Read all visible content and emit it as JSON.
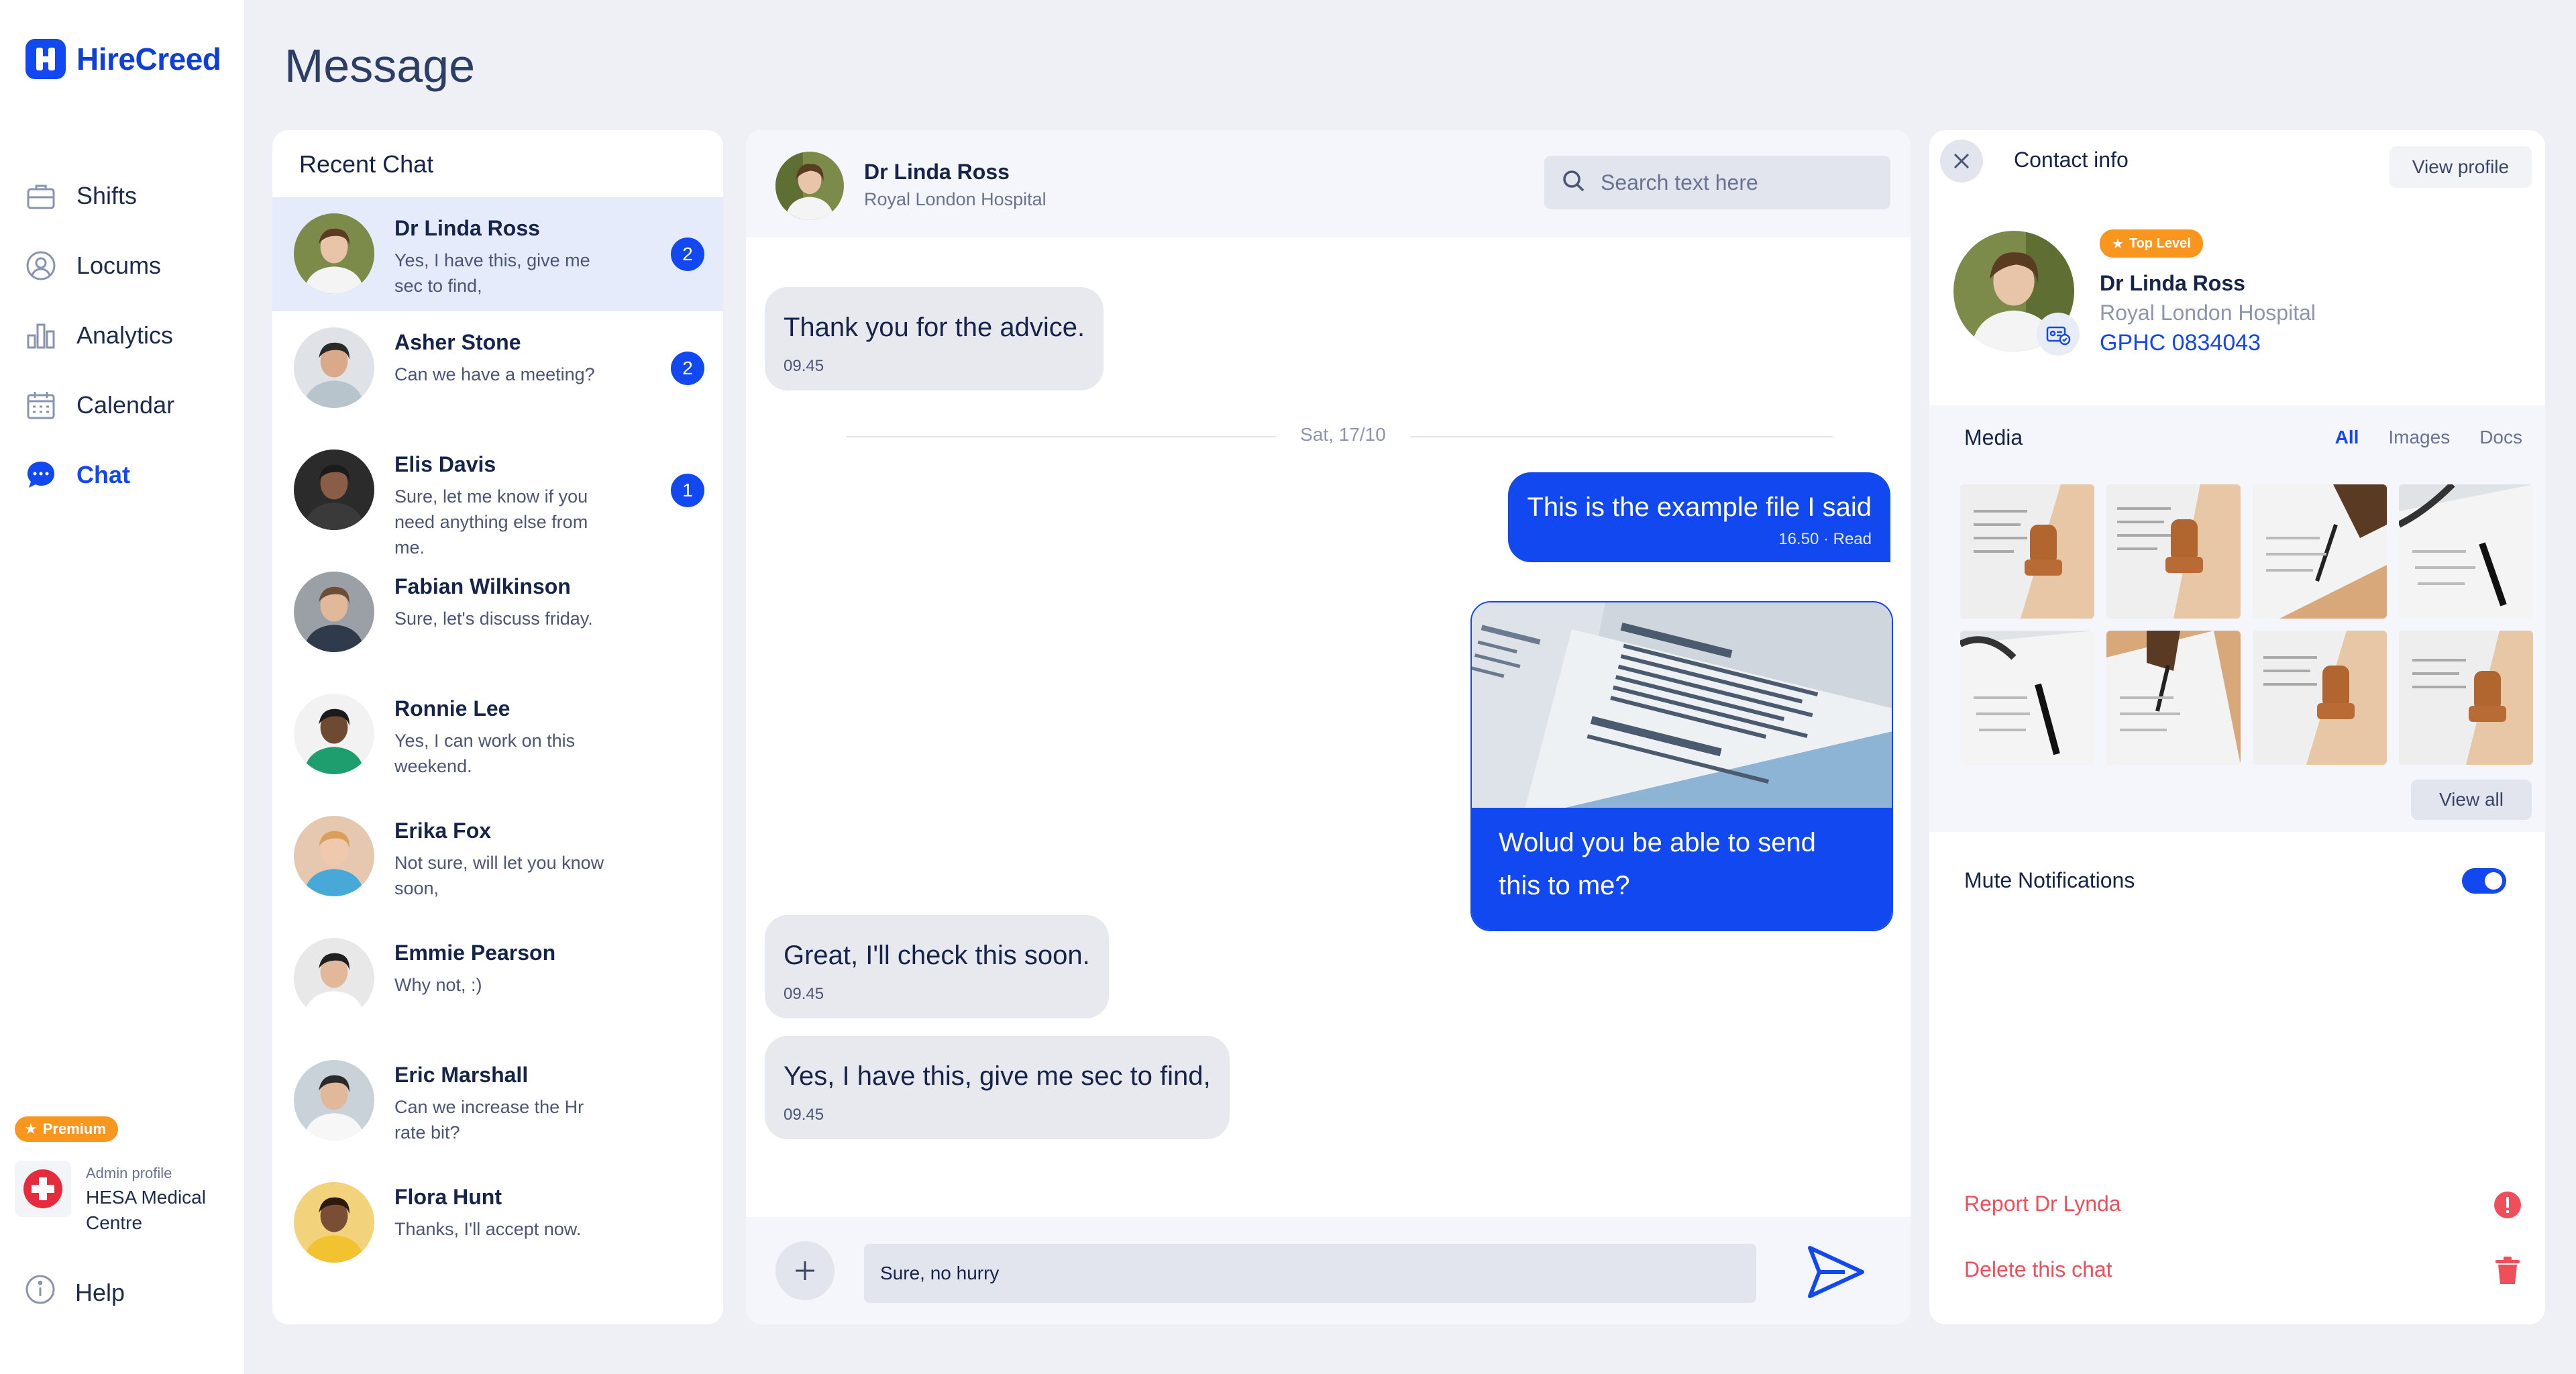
{
  "app": {
    "logo_text": "HireCreed",
    "brand_color": "#1148ef"
  },
  "sidebar": {
    "items": [
      {
        "label": "Shifts",
        "icon": "briefcase-icon"
      },
      {
        "label": "Locums",
        "icon": "user-circle-icon"
      },
      {
        "label": "Analytics",
        "icon": "bar-chart-icon"
      },
      {
        "label": "Calendar",
        "icon": "calendar-icon"
      },
      {
        "label": "Chat",
        "icon": "chat-bubble-icon",
        "active": true
      }
    ],
    "premium_label": "Premium",
    "admin_label": "Admin profile",
    "admin_name": "HESA Medical Centre",
    "help_label": "Help"
  },
  "page_title": "Message",
  "recent_chat": {
    "title": "Recent Chat",
    "chats": [
      {
        "name": "Dr Linda Ross",
        "snippet": "Yes, I have this, give me sec to find,",
        "unread": "2",
        "active": true
      },
      {
        "name": "Asher Stone",
        "snippet": "Can we have a meeting?",
        "unread": "2"
      },
      {
        "name": "Elis Davis",
        "snippet": "Sure, let me know if you need anything else from me.",
        "unread": "1"
      },
      {
        "name": "Fabian Wilkinson",
        "snippet": "Sure, let's discuss friday.",
        "unread": ""
      },
      {
        "name": "Ronnie Lee",
        "snippet": "Yes, I can work on this weekend.",
        "unread": ""
      },
      {
        "name": "Erika Fox",
        "snippet": "Not sure, will let you know soon,",
        "unread": ""
      },
      {
        "name": "Emmie Pearson",
        "snippet": "Why not, :)",
        "unread": ""
      },
      {
        "name": "Eric Marshall",
        "snippet": "Can we increase the Hr rate bit?",
        "unread": ""
      },
      {
        "name": "Flora Hunt",
        "snippet": "Thanks,  I'll accept now.",
        "unread": ""
      }
    ]
  },
  "conversation": {
    "name": "Dr Linda Ross",
    "subtitle": "Royal London Hospital",
    "search_placeholder": "Search text here",
    "messages": [
      {
        "text": "Thank you for the advice.",
        "time": "09.45"
      },
      {
        "date": "Sat, 17/10"
      },
      {
        "text": "This is the example file I said",
        "time": "16.50 · Read"
      },
      {
        "image_caption": "Wolud you be able to send this to me?"
      },
      {
        "text": "Great, I'll check this soon.",
        "time": "09.45"
      },
      {
        "text": "Yes, I have this, give me sec to find,",
        "time": "09.45"
      }
    ],
    "composer_value": "Sure, no hurry"
  },
  "contact_info": {
    "title": "Contact info",
    "view_profile": "View profile",
    "badge": "Top Level",
    "name": "Dr Linda Ross",
    "hospital": "Royal London Hospital",
    "code": "GPHC 0834043",
    "media_title": "Media",
    "tabs": [
      "All",
      "Images",
      "Docs"
    ],
    "view_all": "View all",
    "mute_label": "Mute Notifications",
    "mute_on": true,
    "report_label": "Report Dr Lynda",
    "delete_label": "Delete this chat",
    "danger_color": "#ee4f5a"
  }
}
